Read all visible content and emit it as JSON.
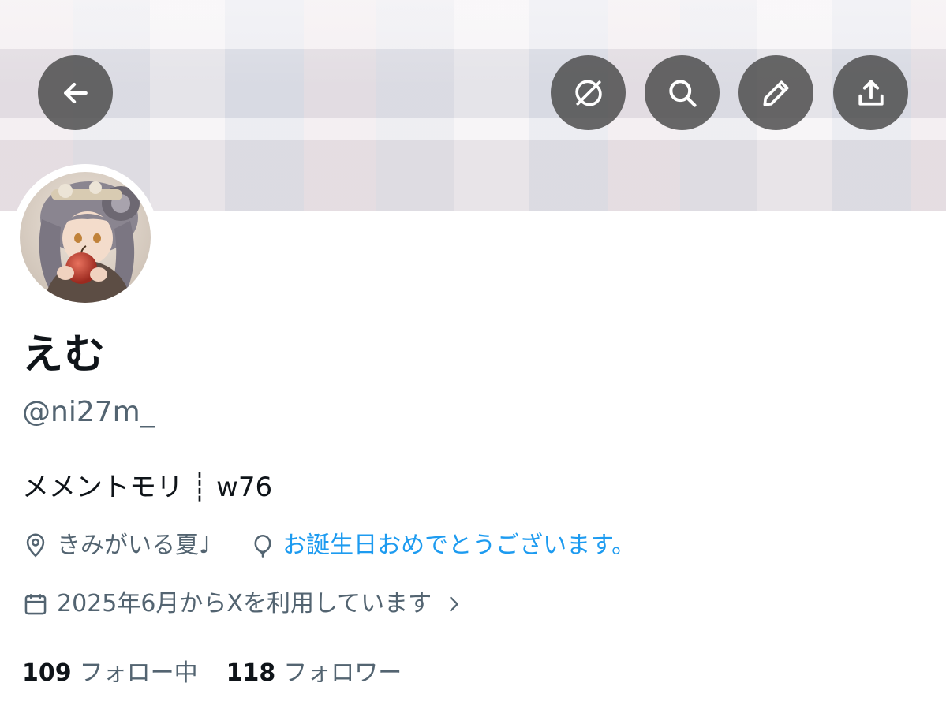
{
  "header": {
    "nav_buttons": [
      {
        "id": "back",
        "icon": "arrow-left-icon"
      },
      {
        "id": "grok",
        "icon": "grok-icon"
      },
      {
        "id": "search",
        "icon": "search-icon"
      },
      {
        "id": "edit",
        "icon": "pencil-icon"
      },
      {
        "id": "share",
        "icon": "share-icon"
      }
    ]
  },
  "profile": {
    "display_name": "えむ",
    "handle": "@ni27m_",
    "bio": "メメントモリ ┊ w76",
    "location": "きみがいる夏♩",
    "birthday_text": "お誕生日おめでとうございます。",
    "joined": "2025年6月からXを利用しています",
    "following_count": "109",
    "following_label": "フォロー中",
    "followers_count": "118",
    "followers_label": "フォロワー"
  },
  "colors": {
    "text_primary": "#0f1419",
    "text_secondary": "#536471",
    "link": "#1d9bf0",
    "nav_button_bg": "#484848"
  }
}
